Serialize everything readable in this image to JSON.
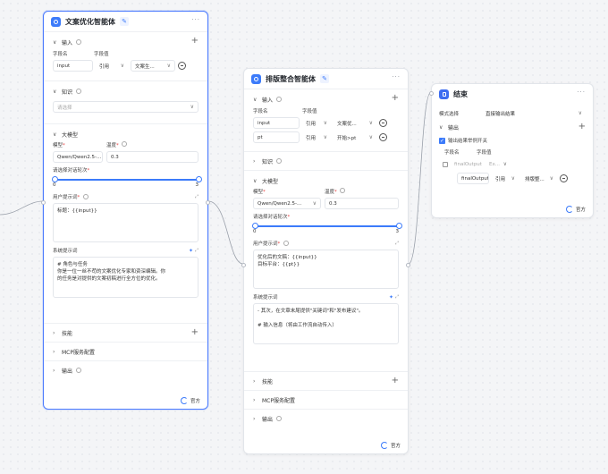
{
  "nodes": {
    "copy_agent": {
      "title": "文案优化智能体",
      "input": {
        "title": "输入",
        "col_name": "字段名",
        "col_value": "字段值",
        "rows": [
          {
            "name": "input",
            "ref": "引用",
            "value": "文案生..."
          }
        ]
      },
      "knowledge": {
        "title": "知识",
        "placeholder": "请选择"
      },
      "llm": {
        "title": "大模型",
        "model_label": "模型",
        "model_value": "Qwen/Qwen2.5-...",
        "temperature_label": "温度",
        "temperature_value": "0.3",
        "rounds_label": "请选择对话轮次",
        "range_min": "0",
        "range_max": "3",
        "user_prompt_label": "用户提示词",
        "user_prompt_text": "标题：{{input}}",
        "system_prompt_label": "系统提示词",
        "system_prompt_lines": [
          "# 角色与任务",
          "你是一位一丝不苟的文案优化专家和资深编辑。你",
          "的任务是对提供的文案初稿进行全方位的优化。"
        ]
      },
      "skills": "技能",
      "mcp": "MCP服务配置",
      "output": "输出",
      "badge": "官方"
    },
    "layout_agent": {
      "title": "排版整合智能体",
      "input": {
        "title": "输入",
        "col_name": "字段名",
        "col_value": "字段值",
        "rows": [
          {
            "name": "input",
            "ref": "引用",
            "value": "文案优..."
          },
          {
            "name": "pt",
            "ref": "引用",
            "value": "开始>pt"
          }
        ]
      },
      "knowledge": {
        "title": "知识"
      },
      "llm": {
        "title": "大模型",
        "model_label": "模型",
        "model_value": "Qwen/Qwen2.5-...",
        "temperature_label": "温度",
        "temperature_value": "0.3",
        "rounds_label": "请选择对话轮次",
        "range_min": "0",
        "range_max": "3",
        "user_prompt_label": "用户提示词",
        "user_prompt_lines": [
          "优化后的文稿：{{input}}",
          "目标平台：{{pt}}"
        ],
        "system_prompt_label": "系统提示词",
        "system_prompt_lines": [
          "- 其次，在文章末尾提供\"关键词\"和\"发布建议\"。",
          "",
          "# 输入信息（将由工作流自动传入）"
        ]
      },
      "skills": "技能",
      "mcp": "MCP服务配置",
      "output": "输出",
      "badge": "官方"
    },
    "end_node": {
      "title": "结束",
      "mode_label": "模式选择",
      "mode_value": "直接输出结果",
      "output_title": "输出",
      "checkbox_label": "输出结果举例开关",
      "col_name": "字段名",
      "col_value": "字段值",
      "parent_field": "finalOutput",
      "parent_type": "Ex...",
      "child_field": "finalOutput",
      "child_ref": "引用",
      "child_value": "排版整...",
      "badge": "官方"
    }
  }
}
